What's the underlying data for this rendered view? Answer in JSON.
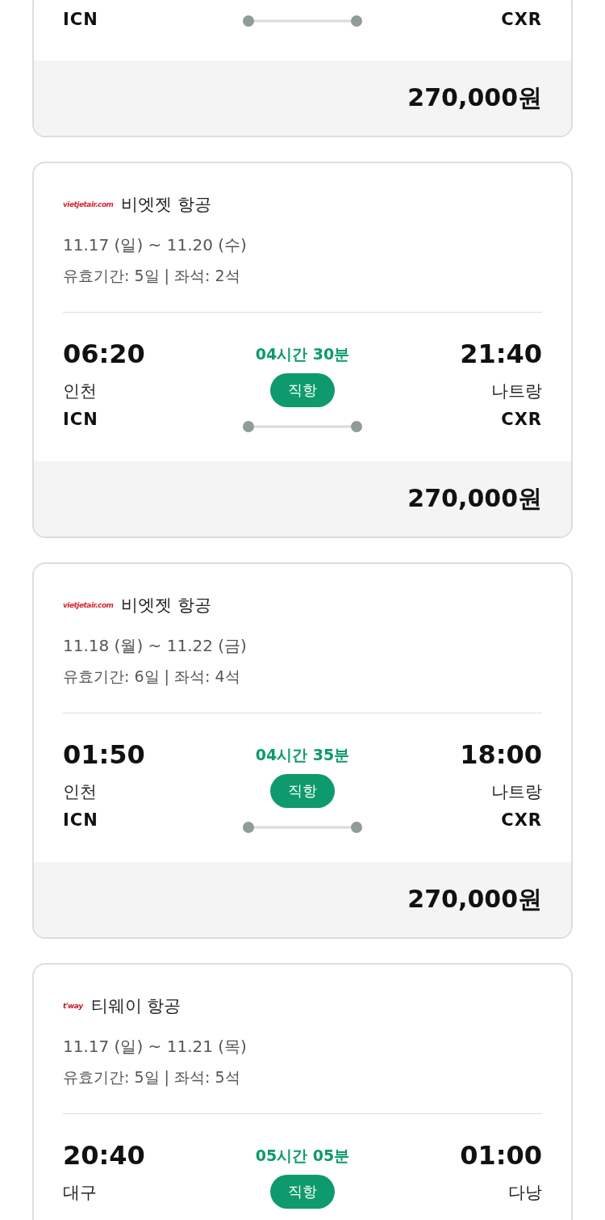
{
  "flights": [
    {
      "origin_code": "ICN",
      "destination_code": "CXR",
      "price": "270,000원"
    },
    {
      "logo": "vietjetair.com",
      "color": "#d7262e",
      "airline": "비엣젯 항공",
      "dates": "11.17 (일) ~ 11.20 (수)",
      "info": "유효기간: 5일 | 좌석: 2석",
      "depart_time": "06:20",
      "duration": "04시간 30분",
      "arrive_time": "21:40",
      "origin_city": "인천",
      "badge": "직항",
      "destination_city": "나트랑",
      "origin_code": "ICN",
      "destination_code": "CXR",
      "price": "270,000원"
    },
    {
      "logo": "vietjetair.com",
      "color": "#d7262e",
      "airline": "비엣젯 항공",
      "dates": "11.18 (월) ~ 11.22 (금)",
      "info": "유효기간: 6일 | 좌석: 4석",
      "depart_time": "01:50",
      "duration": "04시간 35분",
      "arrive_time": "18:00",
      "origin_city": "인천",
      "badge": "직항",
      "destination_city": "나트랑",
      "origin_code": "ICN",
      "destination_code": "CXR",
      "price": "270,000원"
    },
    {
      "logo": "t'way",
      "color": "#c8161d",
      "airline": "티웨이 항공",
      "dates": "11.17 (일) ~ 11.21 (목)",
      "info": "유효기간: 5일 | 좌석: 5석",
      "depart_time": "20:40",
      "duration": "05시간 05분",
      "arrive_time": "01:00",
      "origin_city": "대구",
      "badge": "직항",
      "destination_city": "다낭"
    }
  ]
}
